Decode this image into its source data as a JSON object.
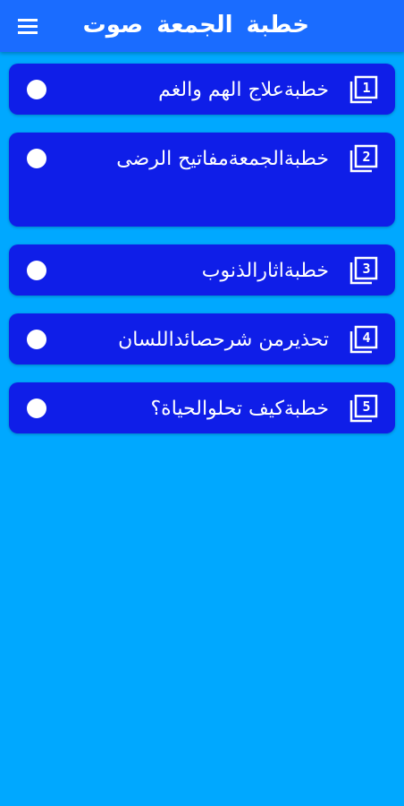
{
  "app_bar": {
    "title": "خطبة الجمعة  صوت",
    "menu_icon": "hamburger-menu-icon",
    "background": "#1a6cff"
  },
  "colors": {
    "page_background": "#00a8ff",
    "card_background": "#0f1ee8",
    "text": "#ffffff"
  },
  "items": [
    {
      "number": "1",
      "label": "خطبةعلاج الهم والغم",
      "icon": "numbered-square-icon"
    },
    {
      "number": "2",
      "label": "خطبةالجمعةمفاتيح الرضى",
      "icon": "numbered-square-icon"
    },
    {
      "number": "3",
      "label": "خطبةاثارالذنوب",
      "icon": "numbered-square-icon"
    },
    {
      "number": "4",
      "label": "تحذيرمن شرحصائداللسان",
      "icon": "numbered-square-icon"
    },
    {
      "number": "5",
      "label": "خطبةكيف تحلوالحياة؟",
      "icon": "numbered-square-icon"
    }
  ]
}
